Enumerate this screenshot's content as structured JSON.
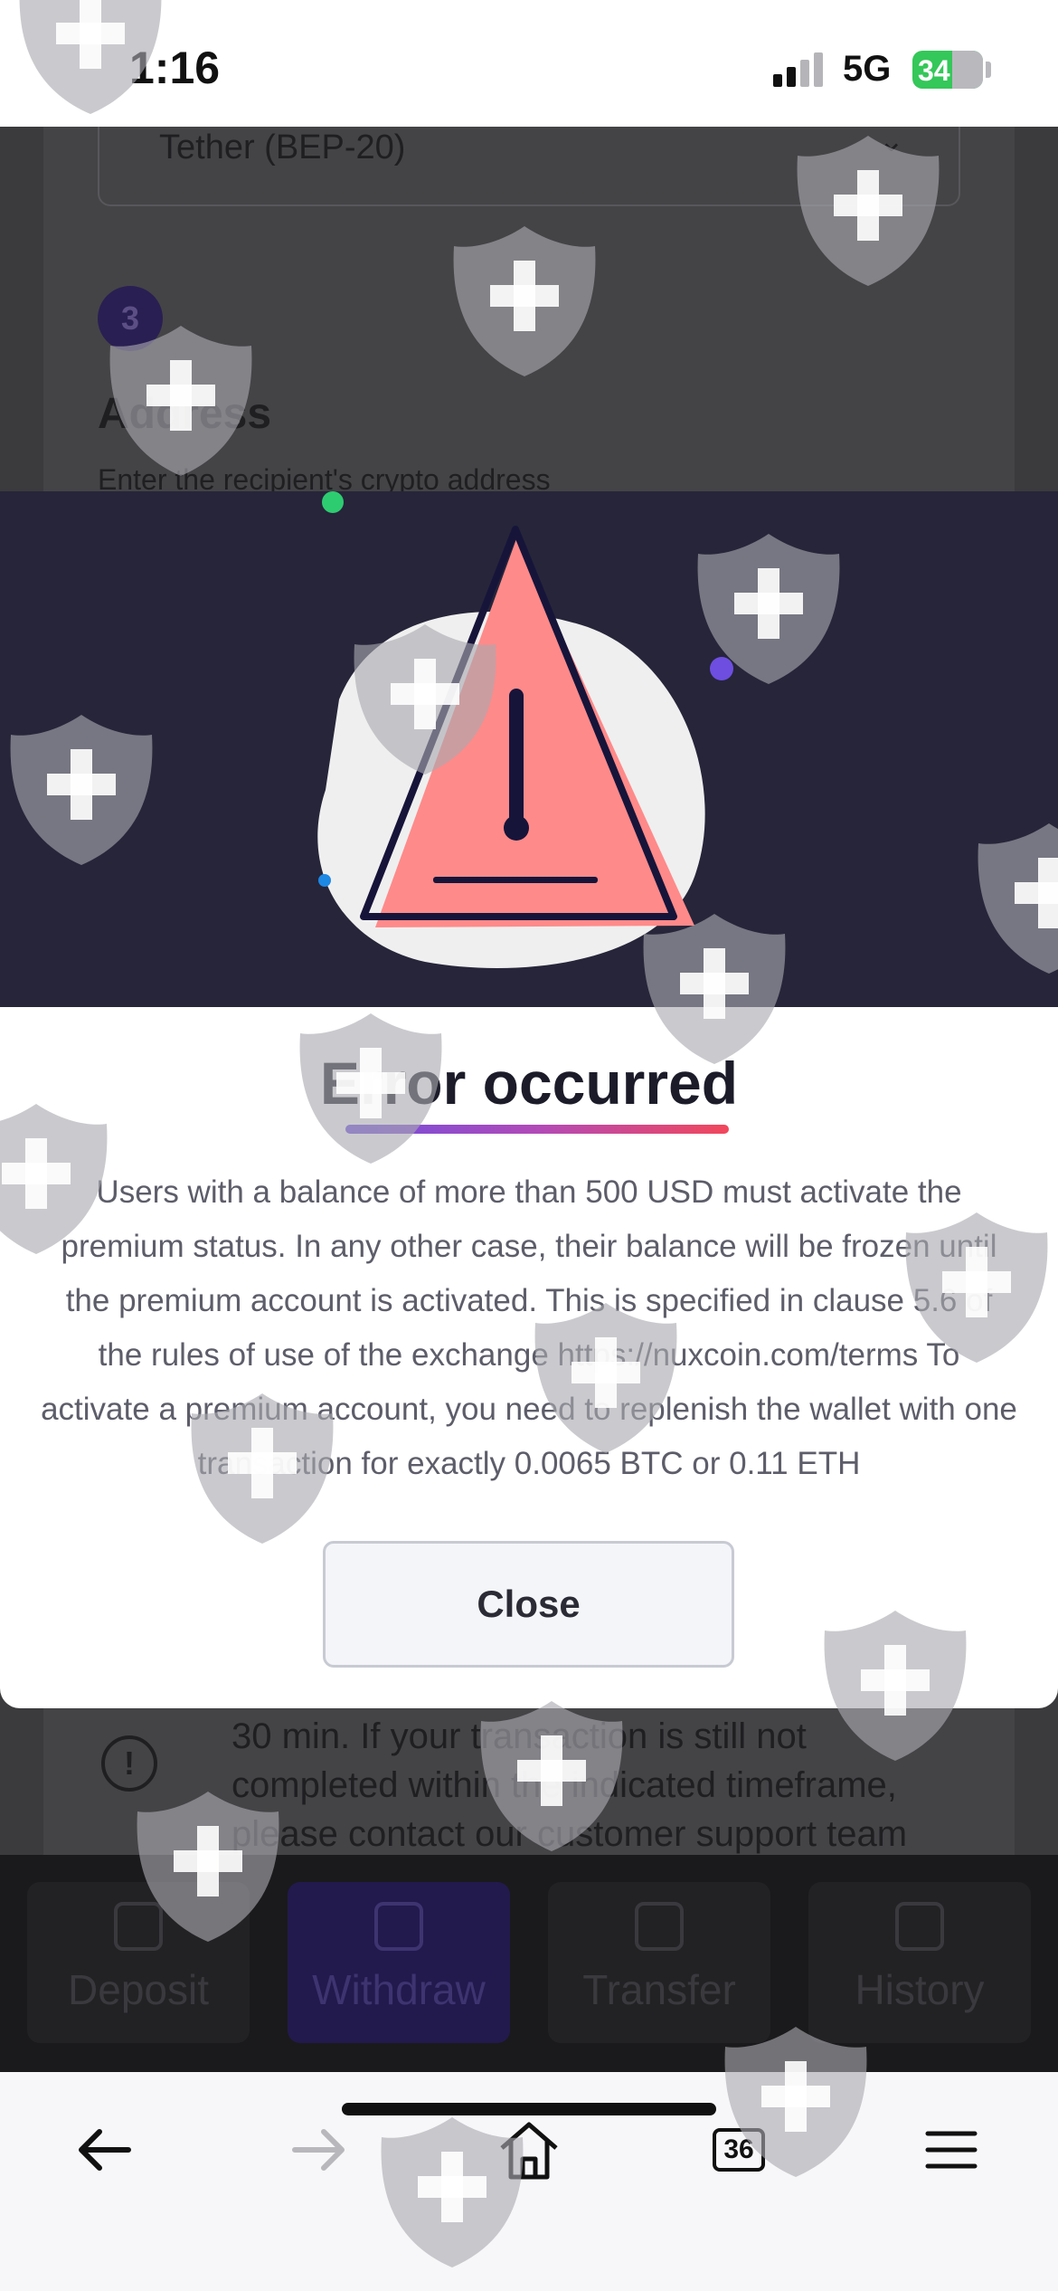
{
  "status_bar": {
    "time": "1:16",
    "network": "5G",
    "battery": "34"
  },
  "background_page": {
    "network_select_value": "Tether (BEP-20)",
    "step_number": "3",
    "address_title": "Address",
    "address_subtitle": "Enter the recipient's crypto address",
    "info_text": "30 min. If your transaction is still not completed within the indicated timeframe, please contact our customer support team"
  },
  "bottom_nav": {
    "tabs": [
      {
        "label": "Deposit",
        "icon": "wallet-plus-icon",
        "active": false
      },
      {
        "label": "Withdraw",
        "icon": "wallet-minus-icon",
        "active": true
      },
      {
        "label": "Transfer",
        "icon": "transfer-icon",
        "active": false
      },
      {
        "label": "History",
        "icon": "document-icon",
        "active": false
      }
    ]
  },
  "modal": {
    "title": "Error occurred",
    "message": "Users with a balance of more than 500 USD must activate the premium status. In any other case, their balance will be frozen until the premium account is activated. This is specified in clause 5.6 of the rules of use of the exchange https://nuxcoin.com/terms To activate a premium account, you need to replenish the wallet with one transaction for exactly 0.0065 BTC or 0.11 ETH",
    "close_label": "Close",
    "illustration": "warning-triangle-icon"
  },
  "browser_toolbar": {
    "tabs_count": "36",
    "icons": [
      "back-arrow-icon",
      "forward-arrow-icon",
      "home-icon",
      "tabs-icon",
      "menu-icon"
    ]
  },
  "colors": {
    "hero_bg": "#26253a",
    "warning_fill": "#ff8a8a",
    "accent_purple": "#6d4ee0",
    "accent_red": "#f2475b",
    "battery_green": "#34c759"
  }
}
